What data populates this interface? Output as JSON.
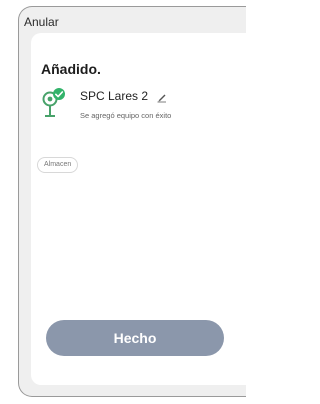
{
  "header": {
    "cancel_label": "Anular"
  },
  "dialog": {
    "title": "Añadido.",
    "device": {
      "name": "SPC Lares 2",
      "subtitle": "Se agregó equipo con éxito",
      "icon": "camera-success-icon"
    },
    "room_chip": "Almacen",
    "done_label": "Hecho"
  },
  "colors": {
    "accent_green": "#32b36a",
    "done_button": "#8b97ab"
  }
}
